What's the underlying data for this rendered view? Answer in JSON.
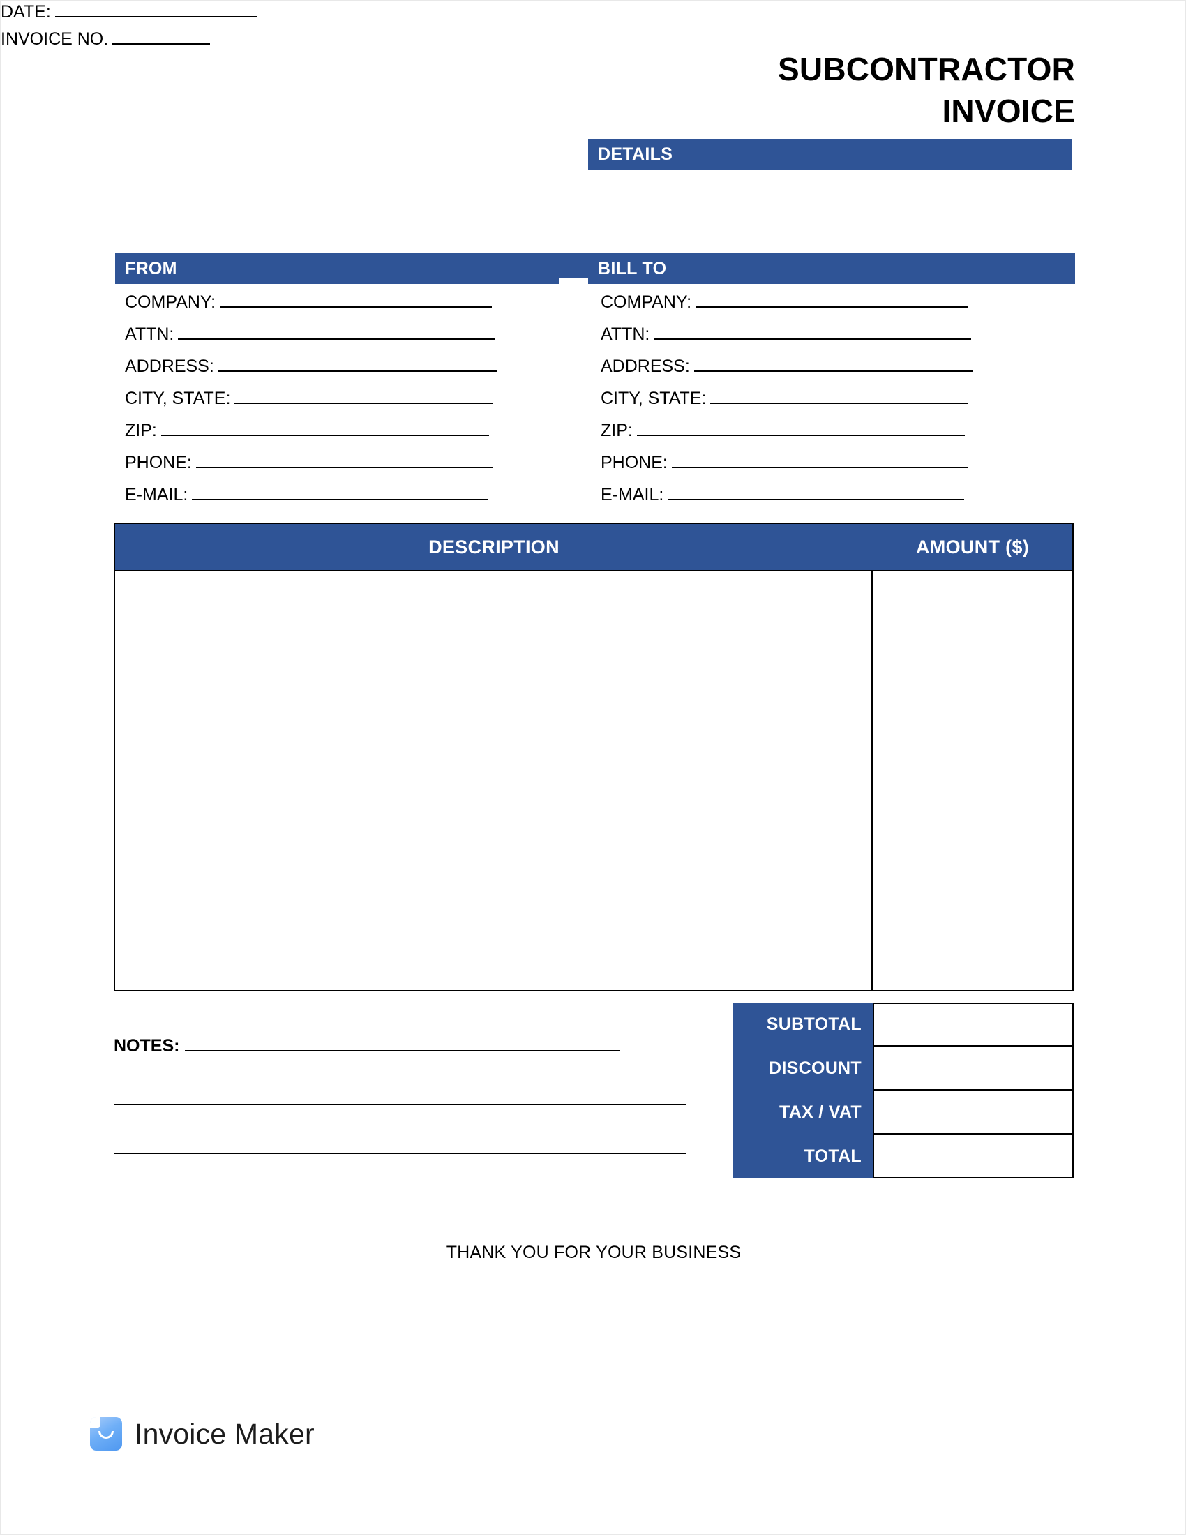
{
  "document": {
    "title_lines": [
      "SUBCONTRACTOR",
      "INVOICE"
    ],
    "accent_color": "#2F5496",
    "text_color": "#000000",
    "page_background": "#FFFFFF"
  },
  "details": {
    "header": "DETAILS",
    "fields": [
      {
        "label": "DATE:",
        "value": "",
        "rule_width": 290
      },
      {
        "label": "INVOICE NO.",
        "value": "",
        "rule_width": 140
      }
    ]
  },
  "from": {
    "header": "FROM",
    "fields": [
      {
        "label": "COMPANY:",
        "value": "",
        "rule_width": 390
      },
      {
        "label": "ATTN:",
        "value": "",
        "rule_width": 455
      },
      {
        "label": "ADDRESS:",
        "value": "",
        "rule_width": 400
      },
      {
        "label": "CITY, STATE:",
        "value": "",
        "rule_width": 370
      },
      {
        "label": "ZIP:",
        "value": "",
        "rule_width": 470
      },
      {
        "label": "PHONE:",
        "value": "",
        "rule_width": 425
      },
      {
        "label": "E-MAIL:",
        "value": "",
        "rule_width": 425
      }
    ]
  },
  "bill_to": {
    "header": "BILL TO",
    "fields": [
      {
        "label": "COMPANY:",
        "value": "",
        "rule_width": 390
      },
      {
        "label": "ATTN:",
        "value": "",
        "rule_width": 455
      },
      {
        "label": "ADDRESS:",
        "value": "",
        "rule_width": 400
      },
      {
        "label": "CITY, STATE:",
        "value": "",
        "rule_width": 370
      },
      {
        "label": "ZIP:",
        "value": "",
        "rule_width": 470
      },
      {
        "label": "PHONE:",
        "value": "",
        "rule_width": 425
      },
      {
        "label": "E-MAIL:",
        "value": "",
        "rule_width": 425
      }
    ]
  },
  "line_items_table": {
    "columns": [
      "DESCRIPTION",
      "AMOUNT ($)"
    ],
    "rows": []
  },
  "notes": {
    "label": "NOTES:",
    "value": "",
    "blank_line_count": 2
  },
  "totals": {
    "rows": [
      {
        "label": "SUBTOTAL",
        "value": ""
      },
      {
        "label": "DISCOUNT",
        "value": ""
      },
      {
        "label": "TAX / VAT",
        "value": ""
      },
      {
        "label": "TOTAL",
        "value": ""
      }
    ]
  },
  "footer": {
    "thank_you": "THANK YOU FOR YOUR BUSINESS"
  },
  "branding": {
    "name": "Invoice Maker",
    "mark_colors": [
      "#A8CCFA",
      "#4F98F0"
    ]
  }
}
